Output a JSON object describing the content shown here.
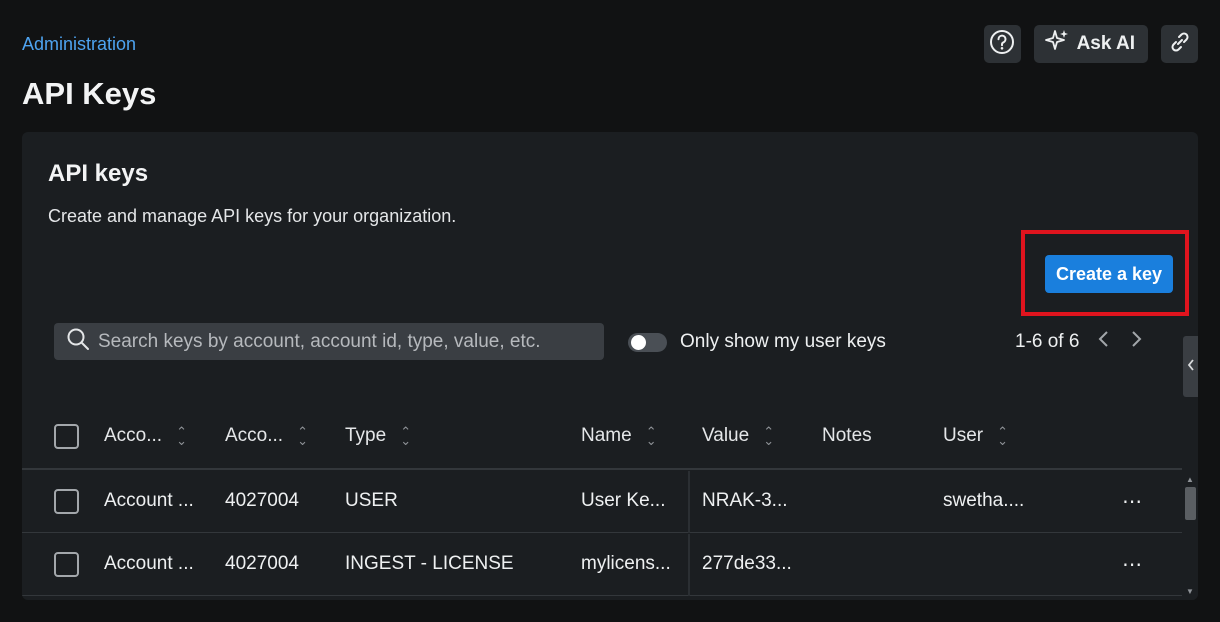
{
  "header": {
    "breadcrumb": "Administration",
    "title": "API Keys",
    "ask_ai_label": "Ask AI"
  },
  "panel": {
    "title": "API keys",
    "description": "Create and manage API keys for your organization.",
    "create_button": "Create a key",
    "search_placeholder": "Search keys by account, account id, type, value, etc.",
    "toggle_label": "Only show my user keys",
    "toggle_on": false,
    "pagination": "1-6 of 6"
  },
  "table": {
    "columns": [
      "Acco...",
      "Acco...",
      "Type",
      "Name",
      "Value",
      "Notes",
      "User"
    ],
    "rows": [
      {
        "account": "Account ...",
        "account_id": "4027004",
        "type": "USER",
        "name": "User Ke...",
        "value": "NRAK-3...",
        "notes": "",
        "user": "swetha....",
        "more": "⋯"
      },
      {
        "account": "Account ...",
        "account_id": "4027004",
        "type": "INGEST - LICENSE",
        "name": "mylicens...",
        "value": "277de33...",
        "notes": "",
        "user": "",
        "more": "⋯"
      }
    ]
  },
  "colors": {
    "background": "#111213",
    "panel": "#1b1e21",
    "accent": "#1a7fdd",
    "link": "#4ea3f0",
    "highlight": "#e0141e"
  },
  "icons": [
    "help-icon",
    "sparkle-icon",
    "link-icon",
    "search-icon",
    "chevron-left-icon",
    "chevron-right-icon",
    "sort-icon",
    "more-icon"
  ]
}
